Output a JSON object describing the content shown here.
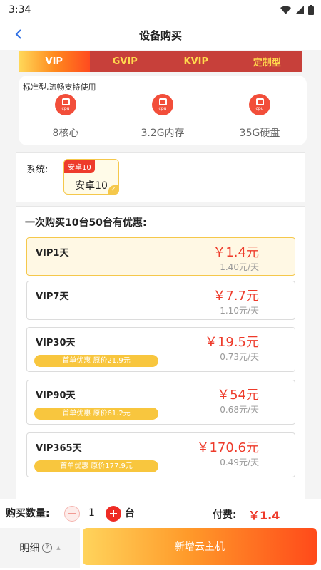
{
  "status_bar": {
    "time": "3:34"
  },
  "header": {
    "title": "设备购买"
  },
  "tabs": [
    {
      "label": "VIP",
      "active": true
    },
    {
      "label": "GVIP",
      "active": false
    },
    {
      "label": "KVIP",
      "active": false
    },
    {
      "label": "定制型",
      "active": false
    }
  ],
  "spec": {
    "note": "标准型,流畅支持使用",
    "icon_text": "cpu",
    "items": [
      {
        "label": "8核心"
      },
      {
        "label": "3.2G内存"
      },
      {
        "label": "35G硬盘"
      }
    ]
  },
  "system": {
    "label": "系统:",
    "option": {
      "tag": "安卓10",
      "name": "安卓10",
      "selected": true
    }
  },
  "plans": {
    "title": "一次购买10台50台有优惠:",
    "items": [
      {
        "name": "VIP1天",
        "price": "￥1.4元",
        "daily": "1.40元/天",
        "badge": "",
        "selected": true
      },
      {
        "name": "VIP7天",
        "price": "￥7.7元",
        "daily": "1.10元/天",
        "badge": "",
        "selected": false
      },
      {
        "name": "VIP30天",
        "price": "￥19.5元",
        "daily": "0.73元/天",
        "badge": "首单优惠 原价21.9元",
        "selected": false
      },
      {
        "name": "VIP90天",
        "price": "￥54元",
        "daily": "0.68元/天",
        "badge": "首单优惠 原价61.2元",
        "selected": false
      },
      {
        "name": "VIP365天",
        "price": "￥170.6元",
        "daily": "0.49元/天",
        "badge": "首单优惠 原价177.9元",
        "selected": false
      }
    ]
  },
  "bottom": {
    "qty_label": "购买数量:",
    "qty_value": "1",
    "unit": "台",
    "pay_label": "付费:",
    "pay_value": "￥1.4",
    "detail_label": "明细",
    "help_glyph": "?",
    "create_label": "新增云主机"
  },
  "colors": {
    "accent_red": "#ee3b2b",
    "accent_yellow": "#f5c84b",
    "tab_bar": "#c7403a"
  }
}
